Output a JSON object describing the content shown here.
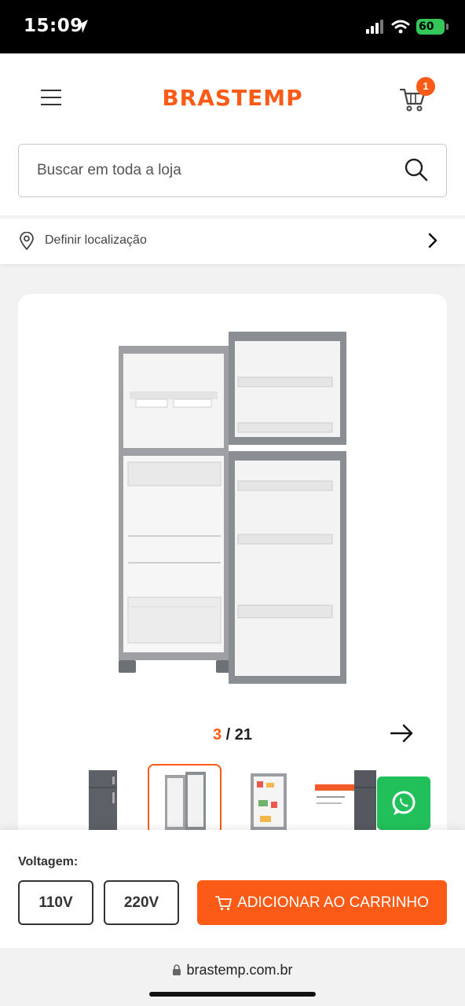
{
  "status_bar": {
    "time": "15:09",
    "battery": "60"
  },
  "header": {
    "logo": "BRASTEMP",
    "cart_count": "1"
  },
  "search": {
    "placeholder": "Buscar em toda a loja"
  },
  "location": {
    "label": "Definir localização"
  },
  "gallery": {
    "current": "3",
    "separator": " / ",
    "total": "21"
  },
  "voltage": {
    "label": "Voltagem:",
    "options": [
      "110V",
      "220V"
    ]
  },
  "cart_button": {
    "label": "ADICIONAR AO CARRINHO"
  },
  "browser": {
    "url": "brastemp.com.br"
  },
  "colors": {
    "brand": "#fc5b17",
    "whatsapp": "#22c05a"
  },
  "icons": [
    "location-arrow-icon",
    "signal-icon",
    "wifi-icon",
    "menu-icon",
    "cart-icon",
    "search-icon",
    "map-pin-icon",
    "chevron-right-icon",
    "arrow-right-icon",
    "whatsapp-icon",
    "lock-icon"
  ]
}
